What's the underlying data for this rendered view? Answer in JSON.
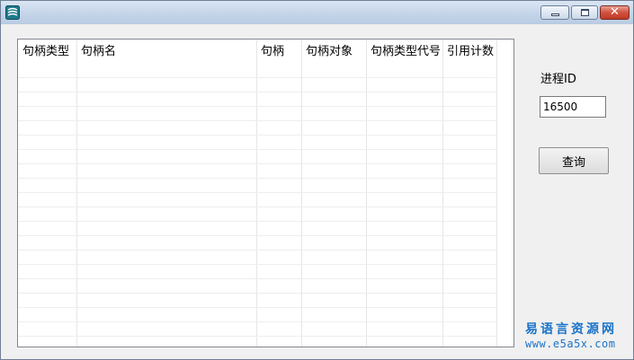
{
  "window": {
    "title": "",
    "controls": {
      "minimize_icon": "minimize-icon",
      "maximize_icon": "maximize-icon",
      "close_glyph": "✕"
    }
  },
  "handle_list": {
    "columns": [
      {
        "label": "句柄类型"
      },
      {
        "label": "句柄名"
      },
      {
        "label": "句柄"
      },
      {
        "label": "句柄对象"
      },
      {
        "label": "句柄类型代号"
      },
      {
        "label": "引用计数"
      }
    ],
    "rows": []
  },
  "process": {
    "label": "进程ID",
    "pid_value": "16500",
    "query_label": "查询"
  },
  "watermark": {
    "title": "易语言资源网",
    "url": "www.e5a5x.com"
  },
  "colors": {
    "watermark": "#1a73c8",
    "close_button": "#c13a27",
    "titlebar": "#c6d6ea"
  }
}
